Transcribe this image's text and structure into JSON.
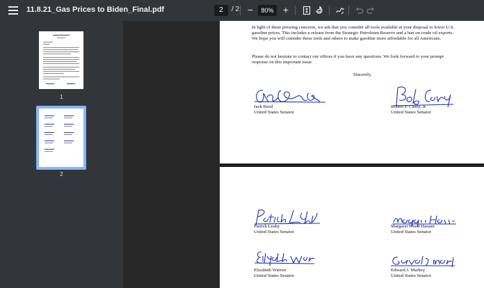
{
  "toolbar": {
    "title": "11.8.21_Gas Prices to Biden_Final.pdf",
    "current_page": "2",
    "page_total": "/ 2",
    "zoom_minus": "−",
    "zoom_level": "80%",
    "zoom_plus": "+"
  },
  "sidebar": {
    "thumbnails": [
      {
        "label": "1"
      },
      {
        "label": "2"
      }
    ]
  },
  "page1": {
    "paragraph1": "In light of these pressing concerns, we ask that you consider all tools available at your disposal to lower U.S. gasoline prices. This includes a release from the Strategic Petroleum Reserve and a ban on crude oil exports. We hope you will consider these tools and others to make gasoline more affordable for all Americans.",
    "paragraph2": "Please do not hesitate to contact our offices if you have any questions. We look forward to your prompt response on this important issue.",
    "closing": "Sincerely,",
    "signers": [
      {
        "name": "Jack Reed",
        "title": "United States Senator"
      },
      {
        "name": "Robert P. Casey, Jr.",
        "title": "United States Senator"
      }
    ]
  },
  "page2": {
    "signers": [
      {
        "name": "Patrick Leahy",
        "title": "United States Senator"
      },
      {
        "name": "Margaret Wood Hassan",
        "title": "United States Senator"
      },
      {
        "name": "Elizabeth Warren",
        "title": "United States Senator"
      },
      {
        "name": "Edward J. Markey",
        "title": "United States Senator"
      }
    ]
  },
  "colors": {
    "toolbar_bg": "#323639",
    "signature_ink": "#1a2fb8",
    "thumbnail_selected": "#8ab4f8"
  },
  "icons": [
    "menu-icon",
    "fit-page-icon",
    "rotate-icon",
    "annotate-icon",
    "undo-icon",
    "redo-icon"
  ]
}
